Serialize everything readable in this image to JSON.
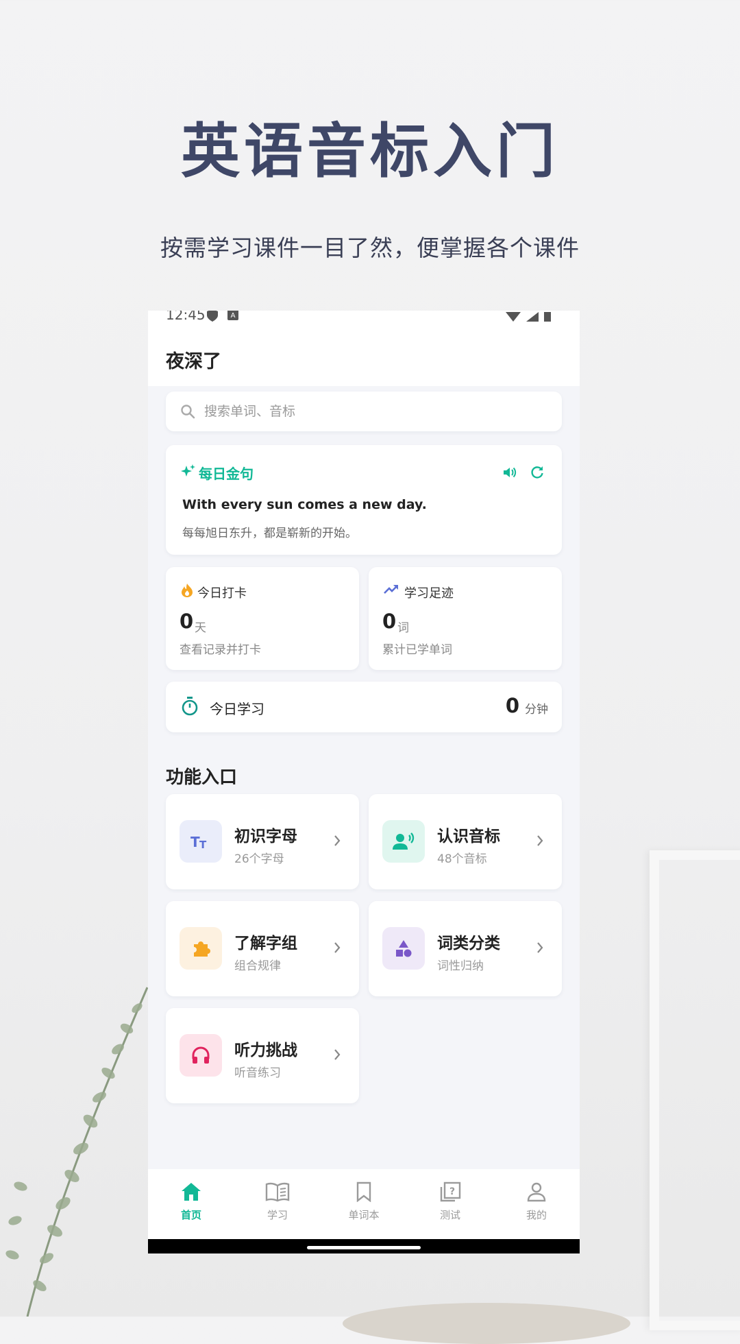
{
  "promo": {
    "title": "英语音标入门",
    "subtitle": "按需学习课件一目了然，便掌握各个课件"
  },
  "status_bar": {
    "time": "12:45"
  },
  "header": {
    "greeting": "夜深了"
  },
  "search": {
    "placeholder": "搜索单词、音标"
  },
  "daily_quote": {
    "title": "每日金句",
    "english": "With every sun comes a new day.",
    "chinese": "每每旭日东升，都是崭新的开始。"
  },
  "stats": [
    {
      "title": "今日打卡",
      "value": "0",
      "unit": "天",
      "desc": "查看记录并打卡"
    },
    {
      "title": "学习足迹",
      "value": "0",
      "unit": "词",
      "desc": "累计已学单词"
    }
  ],
  "today_study": {
    "label": "今日学习",
    "value": "0",
    "unit": "分钟"
  },
  "features_section": {
    "title": "功能入口"
  },
  "features": [
    {
      "title": "初识字母",
      "subtitle": "26个字母",
      "icon": "text-format-icon"
    },
    {
      "title": "认识音标",
      "subtitle": "48个音标",
      "icon": "voice-person-icon"
    },
    {
      "title": "了解字组",
      "subtitle": "组合规律",
      "icon": "puzzle-icon"
    },
    {
      "title": "词类分类",
      "subtitle": "词性归纳",
      "icon": "shapes-icon"
    },
    {
      "title": "听力挑战",
      "subtitle": "听音练习",
      "icon": "headphones-icon"
    }
  ],
  "tabs": [
    {
      "label": "首页",
      "icon": "home-icon",
      "active": true
    },
    {
      "label": "学习",
      "icon": "book-icon"
    },
    {
      "label": "单词本",
      "icon": "bookmark-icon"
    },
    {
      "label": "测试",
      "icon": "quiz-icon"
    },
    {
      "label": "我的",
      "icon": "person-icon"
    }
  ],
  "colors": {
    "accent": "#12b896",
    "promo_title": "#3f4767",
    "fire": "#f5a623",
    "trend": "#5b6fd6"
  }
}
